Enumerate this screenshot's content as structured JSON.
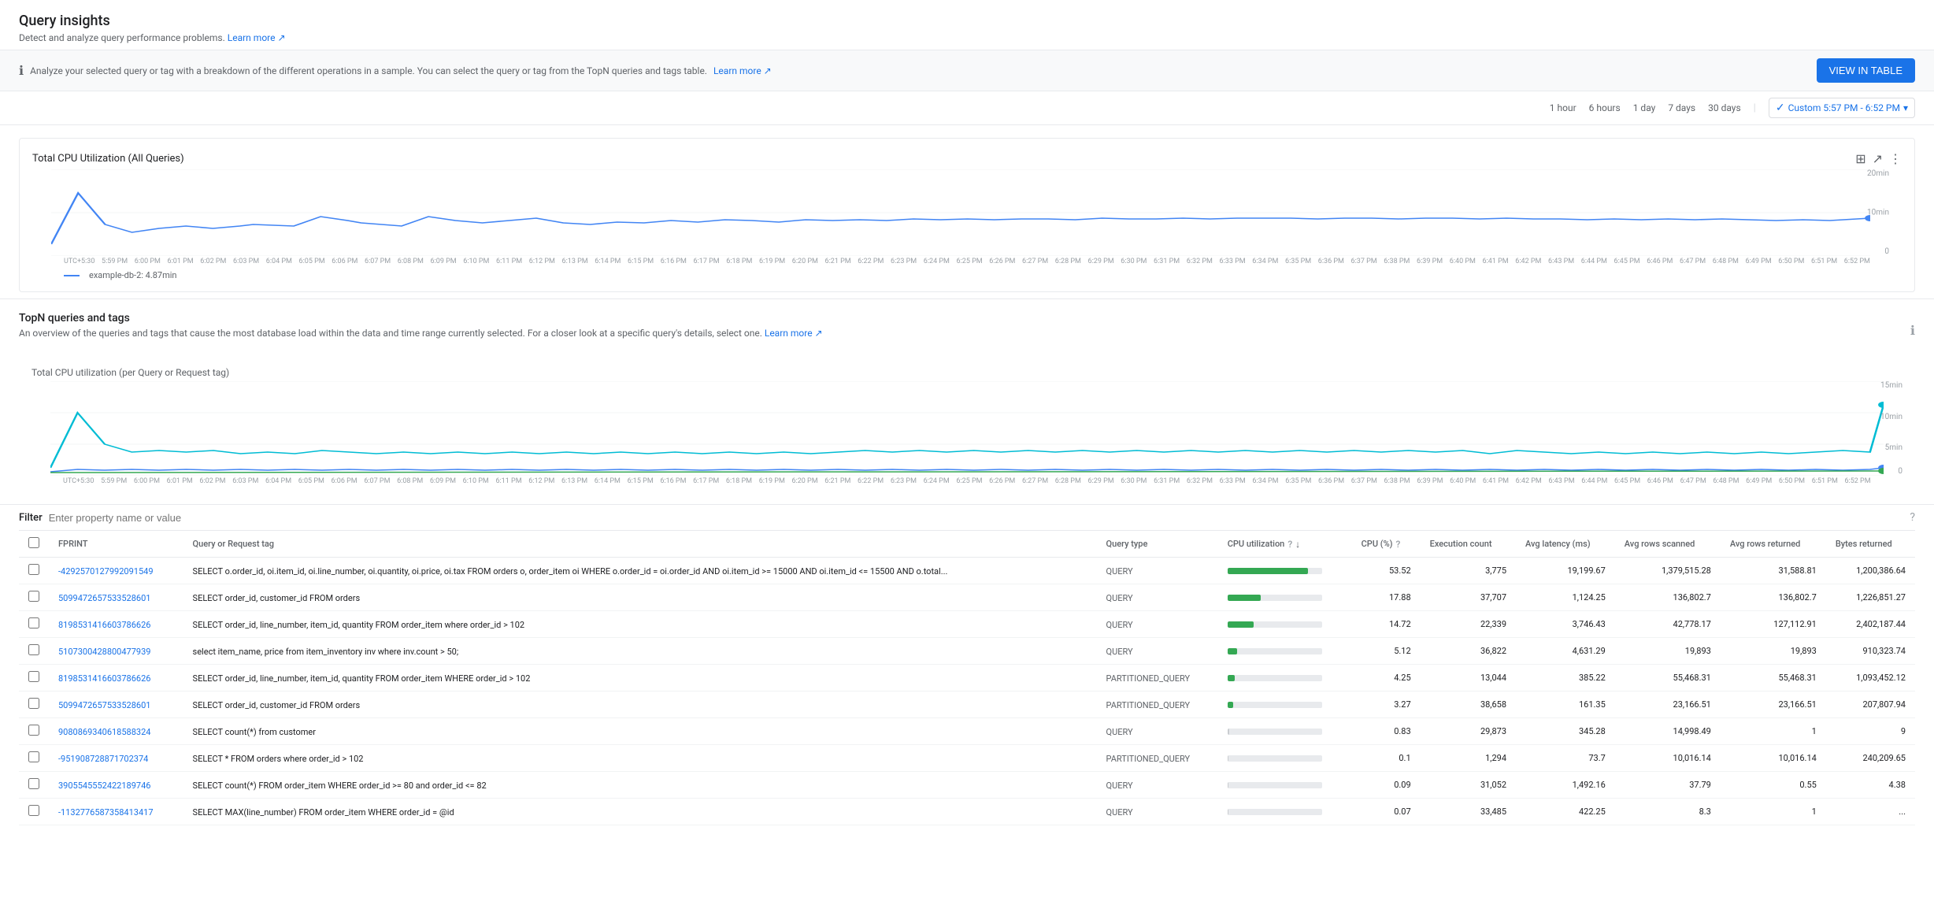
{
  "page": {
    "title": "Query insights",
    "subtitle": "Detect and analyze query performance problems.",
    "subtitle_link": "Learn more",
    "subtitle_link_url": "#"
  },
  "info_banner": {
    "text": "Analyze your selected query or tag with a breakdown of the different operations in a sample. You can select the query or tag from the TopN queries and tags table.",
    "link_text": "Learn more",
    "button_label": "VIEW IN TABLE"
  },
  "time_range": {
    "options": [
      "1 hour",
      "6 hours",
      "1 day",
      "7 days",
      "30 days"
    ],
    "custom_label": "Custom 5:57 PM - 6:52 PM",
    "active": "custom"
  },
  "total_cpu_chart": {
    "title": "Total CPU Utilization (All Queries)",
    "y_labels": [
      "20min",
      "10min",
      "0"
    ],
    "legend": "example-db-2: 4.87min",
    "x_labels": [
      "UTC+5:30",
      "5:59 PM",
      "6:00 PM",
      "6:01 PM",
      "6:02 PM",
      "6:03 PM",
      "6:04 PM",
      "6:05 PM",
      "6:06 PM",
      "6:07 PM",
      "6:08 PM",
      "6:09 PM",
      "6:10 PM",
      "6:11 PM",
      "6:12 PM",
      "6:13 PM",
      "6:14 PM",
      "6:15 PM",
      "6:16 PM",
      "6:17 PM",
      "6:18 PM",
      "6:19 PM",
      "6:20 PM",
      "6:21 PM",
      "6:22 PM",
      "6:23 PM",
      "6:24 PM",
      "6:25 PM",
      "6:26 PM",
      "6:27 PM",
      "6:28 PM",
      "6:29 PM",
      "6:30 PM",
      "6:31 PM",
      "6:32 PM",
      "6:33 PM",
      "6:34 PM",
      "6:35 PM",
      "6:36 PM",
      "6:37 PM",
      "6:38 PM",
      "6:39 PM",
      "6:40 PM",
      "6:41 PM",
      "6:42 PM",
      "6:43 PM",
      "6:44 PM",
      "6:45 PM",
      "6:46 PM",
      "6:47 PM",
      "6:48 PM",
      "6:49 PM",
      "6:50 PM",
      "6:51 PM",
      "6:52 PM"
    ]
  },
  "topn_section": {
    "title": "TopN queries and tags",
    "subtitle": "An overview of the queries and tags that cause the most database load within the data and time range currently selected. For a closer look at a specific query's details, select one.",
    "subtitle_link": "Learn more",
    "chart_title": "Total CPU utilization (per Query or Request tag)",
    "y_labels": [
      "15min",
      "10min",
      "5min",
      "0"
    ]
  },
  "filter": {
    "label": "Filter",
    "placeholder": "Enter property name or value"
  },
  "table": {
    "columns": [
      {
        "id": "checkbox",
        "label": ""
      },
      {
        "id": "fprint",
        "label": "FPRINT"
      },
      {
        "id": "query_tag",
        "label": "Query or Request tag"
      },
      {
        "id": "query_type",
        "label": "Query type"
      },
      {
        "id": "cpu_util",
        "label": "CPU utilization"
      },
      {
        "id": "cpu_pct",
        "label": "CPU (%)"
      },
      {
        "id": "exec_count",
        "label": "Execution count"
      },
      {
        "id": "avg_latency",
        "label": "Avg latency (ms)"
      },
      {
        "id": "avg_rows_scanned",
        "label": "Avg rows scanned"
      },
      {
        "id": "avg_rows_returned",
        "label": "Avg rows returned"
      },
      {
        "id": "bytes_returned",
        "label": "Bytes returned"
      }
    ],
    "rows": [
      {
        "fprint": "-4292570127992091549",
        "query": "SELECT o.order_id, oi.item_id, oi.line_number, oi.quantity, oi.price, oi.tax FROM orders o, order_item oi WHERE o.order_id = oi.order_id AND oi.item_id >= 15000 AND oi.item_id <= 15500 AND o.total...",
        "query_type": "QUERY",
        "cpu_pct": 53.52,
        "cpu_bar": 85,
        "cpu_bar_type": "high",
        "exec_count": "3,775",
        "avg_latency": "19,199.67",
        "avg_rows_scanned": "1,379,515.28",
        "avg_rows_returned": "31,588.81",
        "bytes_returned": "1,200,386.64"
      },
      {
        "fprint": "5099472657533528601",
        "query": "SELECT order_id, customer_id FROM orders",
        "query_type": "QUERY",
        "cpu_pct": 17.88,
        "cpu_bar": 35,
        "cpu_bar_type": "high",
        "exec_count": "37,707",
        "avg_latency": "1,124.25",
        "avg_rows_scanned": "136,802.7",
        "avg_rows_returned": "136,802.7",
        "bytes_returned": "1,226,851.27"
      },
      {
        "fprint": "8198531416603786626",
        "query": "SELECT order_id, line_number, item_id, quantity FROM order_item where order_id > 102",
        "query_type": "QUERY",
        "cpu_pct": 14.72,
        "cpu_bar": 28,
        "cpu_bar_type": "high",
        "exec_count": "22,339",
        "avg_latency": "3,746.43",
        "avg_rows_scanned": "42,778.17",
        "avg_rows_returned": "127,112.91",
        "bytes_returned": "2,402,187.44"
      },
      {
        "fprint": "5107300428800477939",
        "query": "select item_name, price from item_inventory inv where inv.count > 50;",
        "query_type": "QUERY",
        "cpu_pct": 5.12,
        "cpu_bar": 10,
        "cpu_bar_type": "medium",
        "exec_count": "36,822",
        "avg_latency": "4,631.29",
        "avg_rows_scanned": "19,893",
        "avg_rows_returned": "19,893",
        "bytes_returned": "910,323.74"
      },
      {
        "fprint": "8198531416603786626",
        "query": "SELECT order_id, line_number, item_id, quantity FROM order_item WHERE order_id > 102",
        "query_type": "PARTITIONED_QUERY",
        "cpu_pct": 4.25,
        "cpu_bar": 8,
        "cpu_bar_type": "medium",
        "exec_count": "13,044",
        "avg_latency": "385.22",
        "avg_rows_scanned": "55,468.31",
        "avg_rows_returned": "55,468.31",
        "bytes_returned": "1,093,452.12"
      },
      {
        "fprint": "5099472657533528601",
        "query": "SELECT order_id, customer_id FROM orders",
        "query_type": "PARTITIONED_QUERY",
        "cpu_pct": 3.27,
        "cpu_bar": 6,
        "cpu_bar_type": "medium",
        "exec_count": "38,658",
        "avg_latency": "161.35",
        "avg_rows_scanned": "23,166.51",
        "avg_rows_returned": "23,166.51",
        "bytes_returned": "207,807.94"
      },
      {
        "fprint": "9080869340618588324",
        "query": "SELECT count(*) from customer",
        "query_type": "QUERY",
        "cpu_pct": 0.83,
        "cpu_bar": 2,
        "cpu_bar_type": "low",
        "exec_count": "29,873",
        "avg_latency": "345.28",
        "avg_rows_scanned": "14,998.49",
        "avg_rows_returned": "1",
        "bytes_returned": "9"
      },
      {
        "fprint": "-951908728871702374",
        "query": "SELECT * FROM orders where order_id > 102",
        "query_type": "PARTITIONED_QUERY",
        "cpu_pct": 0.1,
        "cpu_bar": 1,
        "cpu_bar_type": "low",
        "exec_count": "1,294",
        "avg_latency": "73.7",
        "avg_rows_scanned": "10,016.14",
        "avg_rows_returned": "10,016.14",
        "bytes_returned": "240,209.65"
      },
      {
        "fprint": "3905545552422189746",
        "query": "SELECT count(*) FROM order_item WHERE order_id >= 80 and order_id <= 82",
        "query_type": "QUERY",
        "cpu_pct": 0.09,
        "cpu_bar": 1,
        "cpu_bar_type": "low",
        "exec_count": "31,052",
        "avg_latency": "1,492.16",
        "avg_rows_scanned": "37.79",
        "avg_rows_returned": "0.55",
        "bytes_returned": "4.38"
      },
      {
        "fprint": "-1132776587358413417",
        "query": "SELECT MAX(line_number) FROM order_item WHERE order_id = @id",
        "query_type": "QUERY",
        "cpu_pct": 0.07,
        "cpu_bar": 1,
        "cpu_bar_type": "low",
        "exec_count": "33,485",
        "avg_latency": "422.25",
        "avg_rows_scanned": "8.3",
        "avg_rows_returned": "1",
        "bytes_returned": "..."
      }
    ]
  }
}
